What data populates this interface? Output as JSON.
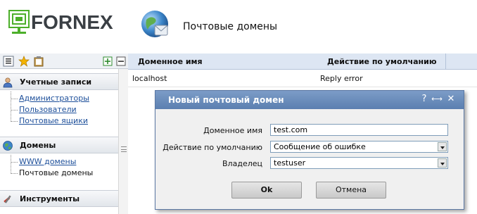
{
  "header": {
    "logo_text": "FORNEX",
    "page_title": "Почтовые домены"
  },
  "toolbar": {
    "icons": [
      "list-icon",
      "star-icon",
      "clipboard-icon",
      "expand-all-icon",
      "collapse-all-icon"
    ]
  },
  "sidebar": {
    "sections": [
      {
        "title": "Учетные записи",
        "icon": "users-icon",
        "items": [
          {
            "label": "Администраторы",
            "link": true
          },
          {
            "label": "Пользователи",
            "link": true
          },
          {
            "label": "Почтовые ящики",
            "link": true
          }
        ]
      },
      {
        "title": "Домены",
        "icon": "globe-icon",
        "items": [
          {
            "label": "WWW домены",
            "link": true
          },
          {
            "label": "Почтовые домены",
            "link": false
          }
        ]
      },
      {
        "title": "Инструменты",
        "icon": "tools-icon",
        "items": []
      }
    ]
  },
  "table": {
    "columns": [
      "Доменное имя",
      "Действие по умолчанию"
    ],
    "rows": [
      [
        "localhost",
        "Reply error"
      ]
    ]
  },
  "dialog": {
    "title": "Новый почтовый домен",
    "controls": [
      "?",
      "⟷",
      "✕"
    ],
    "fields": [
      {
        "label": "Доменное имя",
        "value": "test.com",
        "type": "text"
      },
      {
        "label": "Действие по умолчанию",
        "value": "Сообщение об ошибке",
        "type": "select"
      },
      {
        "label": "Владелец",
        "value": "testuser",
        "type": "select"
      }
    ],
    "ok_label": "Ok",
    "cancel_label": "Отмена"
  },
  "colors": {
    "accent": "#5b7fb0",
    "logo_green": "#4caf2a",
    "header_bg": "#dde6f3"
  }
}
